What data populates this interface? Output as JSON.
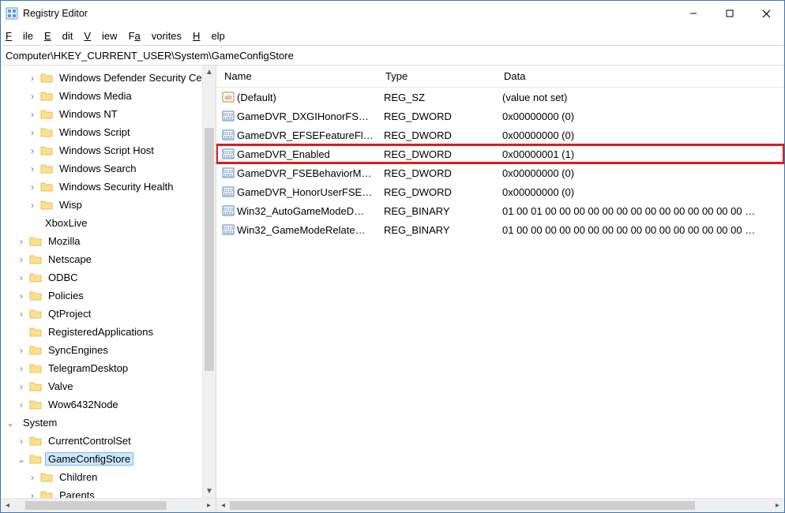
{
  "window": {
    "title": "Registry Editor"
  },
  "menu": {
    "file": "File",
    "edit": "Edit",
    "view": "View",
    "favorites": "Favorites",
    "help": "Help"
  },
  "address": {
    "path": "Computer\\HKEY_CURRENT_USER\\System\\GameConfigStore"
  },
  "tree": {
    "items": [
      {
        "label": "Windows Defender Security Ce",
        "depth": 1,
        "twisty": ">"
      },
      {
        "label": "Windows Media",
        "depth": 1,
        "twisty": ">"
      },
      {
        "label": "Windows NT",
        "depth": 1,
        "twisty": ">"
      },
      {
        "label": "Windows Script",
        "depth": 1,
        "twisty": ">"
      },
      {
        "label": "Windows Script Host",
        "depth": 1,
        "twisty": ">"
      },
      {
        "label": "Windows Search",
        "depth": 1,
        "twisty": ">"
      },
      {
        "label": "Windows Security Health",
        "depth": 1,
        "twisty": ">"
      },
      {
        "label": "Wisp",
        "depth": 1,
        "twisty": ">"
      },
      {
        "label": "XboxLive",
        "depth": 1,
        "twisty": "",
        "nofolder": true
      },
      {
        "label": "Mozilla",
        "depth": 0,
        "twisty": ">"
      },
      {
        "label": "Netscape",
        "depth": 0,
        "twisty": ">"
      },
      {
        "label": "ODBC",
        "depth": 0,
        "twisty": ">"
      },
      {
        "label": "Policies",
        "depth": 0,
        "twisty": ">"
      },
      {
        "label": "QtProject",
        "depth": 0,
        "twisty": ">"
      },
      {
        "label": "RegisteredApplications",
        "depth": 0,
        "twisty": ""
      },
      {
        "label": "SyncEngines",
        "depth": 0,
        "twisty": ">"
      },
      {
        "label": "TelegramDesktop",
        "depth": 0,
        "twisty": ">"
      },
      {
        "label": "Valve",
        "depth": 0,
        "twisty": ">"
      },
      {
        "label": "Wow6432Node",
        "depth": 0,
        "twisty": ">"
      },
      {
        "label": "System",
        "depth": -1,
        "twisty": "v",
        "nofolder": true
      },
      {
        "label": "CurrentControlSet",
        "depth": 0,
        "twisty": ">"
      },
      {
        "label": "GameConfigStore",
        "depth": 0,
        "twisty": "v",
        "selected": true
      },
      {
        "label": "Children",
        "depth": 1,
        "twisty": ">"
      },
      {
        "label": "Parents",
        "depth": 1,
        "twisty": ">"
      }
    ]
  },
  "list": {
    "headers": {
      "name": "Name",
      "type": "Type",
      "data": "Data"
    },
    "rows": [
      {
        "icon": "str",
        "name": "(Default)",
        "type": "REG_SZ",
        "data": "(value not set)"
      },
      {
        "icon": "bin",
        "name": "GameDVR_DXGIHonorFS…",
        "type": "REG_DWORD",
        "data": "0x00000000 (0)"
      },
      {
        "icon": "bin",
        "name": "GameDVR_EFSEFeatureFl…",
        "type": "REG_DWORD",
        "data": "0x00000000 (0)"
      },
      {
        "icon": "bin",
        "name": "GameDVR_Enabled",
        "type": "REG_DWORD",
        "data": "0x00000001 (1)",
        "highlight": true
      },
      {
        "icon": "bin",
        "name": "GameDVR_FSEBehaviorM…",
        "type": "REG_DWORD",
        "data": "0x00000000 (0)"
      },
      {
        "icon": "bin",
        "name": "GameDVR_HonorUserFSE…",
        "type": "REG_DWORD",
        "data": "0x00000000 (0)"
      },
      {
        "icon": "bin",
        "name": "Win32_AutoGameModeD…",
        "type": "REG_BINARY",
        "data": "01 00 01 00 00 00 00 00 00 00 00 00 00 00 00 00 00 …"
      },
      {
        "icon": "bin",
        "name": "Win32_GameModeRelate…",
        "type": "REG_BINARY",
        "data": "01 00 00 00 00 00 00 00 00 00 00 00 00 00 00 00 00 …"
      }
    ]
  }
}
